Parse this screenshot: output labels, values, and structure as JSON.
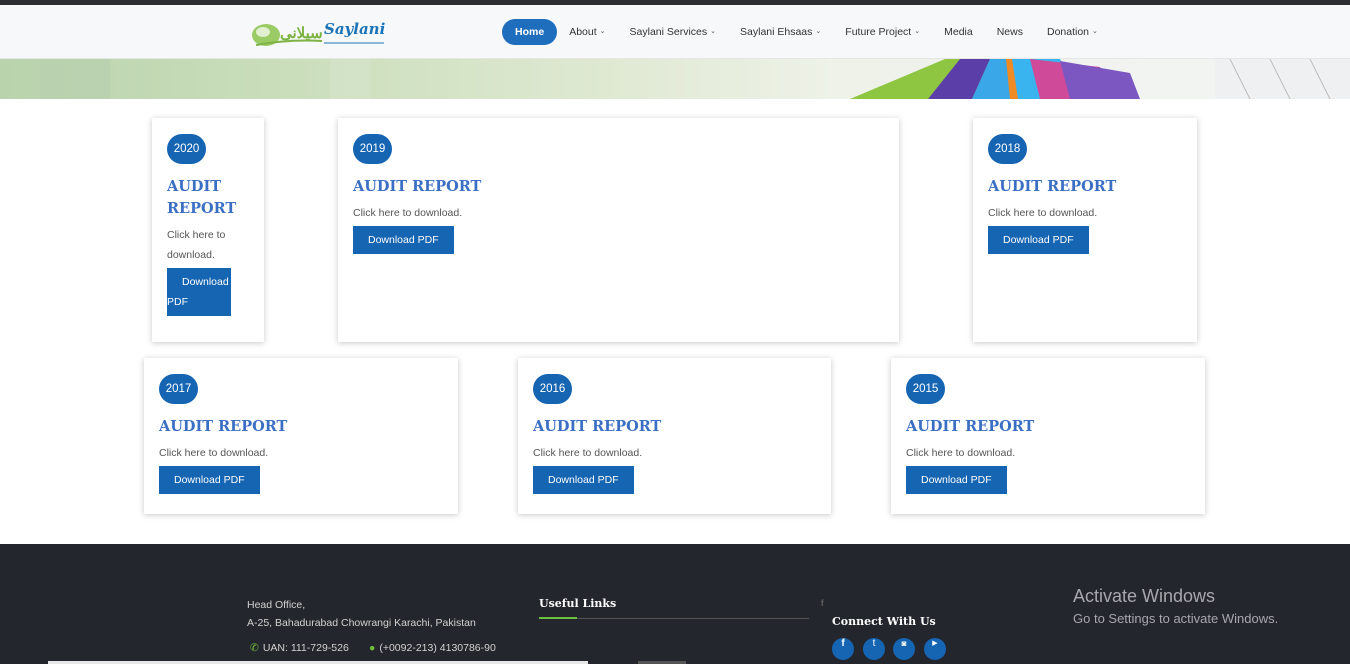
{
  "header": {
    "logo_brand": "Saylani",
    "logo_urdu": "سیلانی",
    "nav": [
      {
        "label": "Home",
        "has_dropdown": false
      },
      {
        "label": "About",
        "has_dropdown": true
      },
      {
        "label": "Saylani Services",
        "has_dropdown": true
      },
      {
        "label": "Saylani Ehsaas",
        "has_dropdown": true
      },
      {
        "label": "Future Project",
        "has_dropdown": true
      },
      {
        "label": "Media",
        "has_dropdown": false
      },
      {
        "label": "News",
        "has_dropdown": false
      },
      {
        "label": "Donation",
        "has_dropdown": true
      }
    ]
  },
  "cards": [
    {
      "year": "2020",
      "title": "AUDIT REPORT",
      "description": "Click here to download.",
      "button": "Download PDF"
    },
    {
      "year": "2019",
      "title": "AUDIT REPORT",
      "description": "Click here to download.",
      "button": "Download PDF"
    },
    {
      "year": "2018",
      "title": "AUDIT REPORT",
      "description": "Click here to download.",
      "button": "Download PDF"
    },
    {
      "year": "2017",
      "title": "AUDIT REPORT",
      "description": "Click here to download.",
      "button": "Download PDF"
    },
    {
      "year": "2016",
      "title": "AUDIT REPORT",
      "description": "Click here to download.",
      "button": "Download PDF"
    },
    {
      "year": "2015",
      "title": "AUDIT REPORT",
      "description": "Click here to download.",
      "button": "Download PDF"
    }
  ],
  "footer": {
    "address_line1": "Head Office,",
    "address_line2": "A-25, Bahadurabad Chowrangi Karachi, Pakistan",
    "uan": "UAN: 111-729-526",
    "phone": "(+0092-213) 4130786-90",
    "useful_links_heading": "Useful Links",
    "connect_heading": "Connect With Us",
    "stray_char": "f",
    "social": [
      {
        "icon": "facebook-icon",
        "glyph": "f"
      },
      {
        "icon": "twitter-icon",
        "glyph": "t"
      },
      {
        "icon": "instagram-icon",
        "glyph": "◙"
      },
      {
        "icon": "youtube-icon",
        "glyph": "▶"
      }
    ]
  },
  "windows_watermark": {
    "line1": "Activate Windows",
    "line2": "Go to Settings to activate Windows."
  },
  "colors": {
    "accent": "#1565b3",
    "title": "#3a6fc4",
    "footer_bg": "#24262d",
    "footer_accent": "#6fbf3c"
  }
}
